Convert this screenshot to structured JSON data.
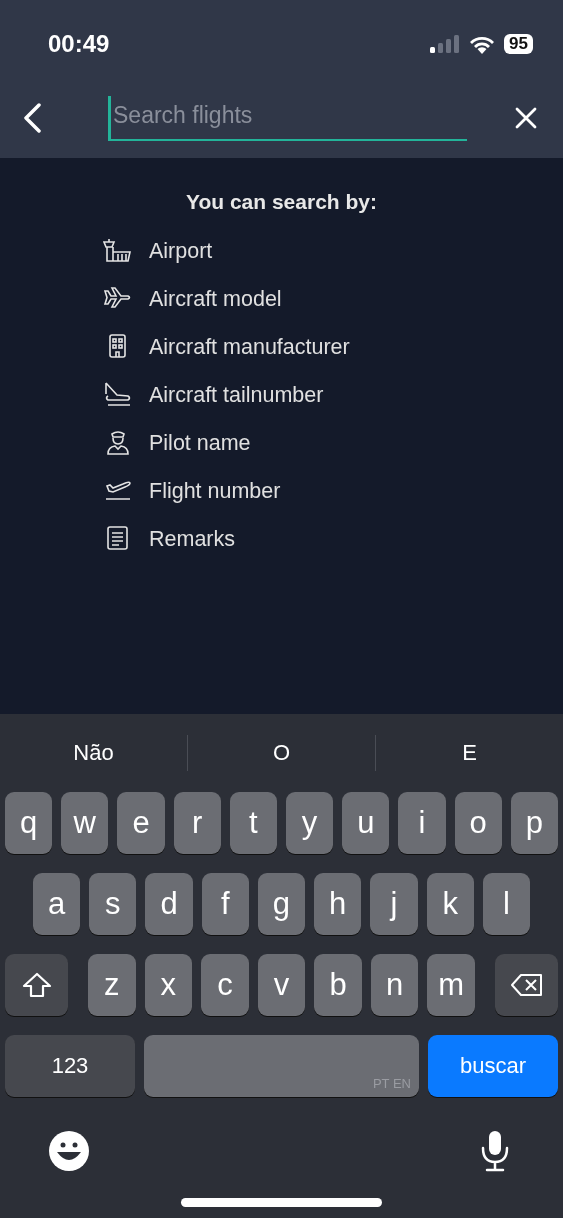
{
  "status_bar": {
    "time": "00:49",
    "battery": "95"
  },
  "search": {
    "placeholder": "Search flights"
  },
  "heading": "You can search by:",
  "options": [
    {
      "kind": "tower",
      "label": "Airport"
    },
    {
      "kind": "plane",
      "label": "Aircraft model"
    },
    {
      "kind": "building",
      "label": "Aircraft manufacturer"
    },
    {
      "kind": "tail",
      "label": "Aircraft tailnumber"
    },
    {
      "kind": "pilot",
      "label": "Pilot name"
    },
    {
      "kind": "takeoff",
      "label": "Flight number"
    },
    {
      "kind": "note",
      "label": "Remarks"
    }
  ],
  "suggestions": [
    "Não",
    "O",
    "E"
  ],
  "keyboard": {
    "rows": [
      [
        "q",
        "w",
        "e",
        "r",
        "t",
        "y",
        "u",
        "i",
        "o",
        "p"
      ],
      [
        "a",
        "s",
        "d",
        "f",
        "g",
        "h",
        "j",
        "k",
        "l"
      ],
      [
        "z",
        "x",
        "c",
        "v",
        "b",
        "n",
        "m"
      ]
    ],
    "numbers_key": "123",
    "space_languages": "PT EN",
    "return_key": "buscar"
  }
}
